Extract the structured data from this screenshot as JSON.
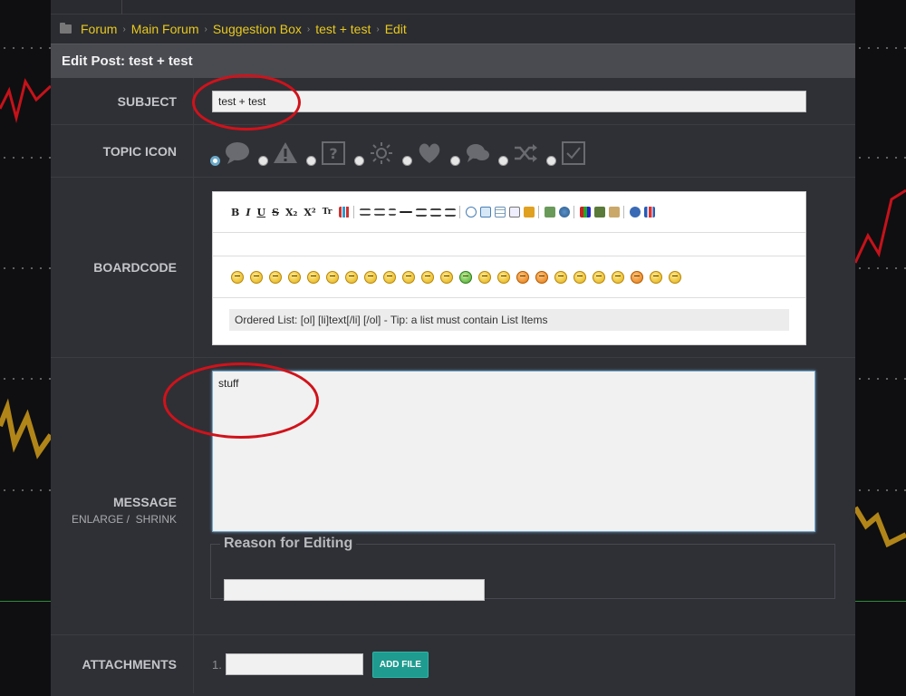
{
  "breadcrumb": [
    "Forum",
    "Main Forum",
    "Suggestion Box",
    "test + test",
    "Edit"
  ],
  "page_title": "Edit Post: test + test",
  "labels": {
    "subject": "SUBJECT",
    "topic_icon": "TOPIC ICON",
    "boardcode": "BOARDCODE",
    "message": "MESSAGE",
    "enlarge": "ENLARGE",
    "shrink": "SHRINK",
    "attachments": "ATTACHMENTS"
  },
  "subject_value": "test + test",
  "message_value": "stuff",
  "boardcode_hint": "Ordered List: [ol] [li]text[/li] [/ol] - Tip: a list must contain List Items",
  "toolbar_text": {
    "bold": "B",
    "italic": "I",
    "underline": "U",
    "strike": "S",
    "subscript": "X₂",
    "superscript": "X²",
    "text_size": "Tr"
  },
  "reason_legend": "Reason for Editing",
  "attachment_number": "1.",
  "add_file_label": "ADD FILE",
  "topic_icons": [
    "speech-bubble-icon",
    "warning-icon",
    "question-icon",
    "sun-icon",
    "heart-icon",
    "chat-icon",
    "shuffle-icon",
    "checkbox-icon"
  ],
  "colors": {
    "accent_link": "#e8c91e",
    "button_teal": "#1f9b8f",
    "annotation_red": "#d1121a"
  }
}
